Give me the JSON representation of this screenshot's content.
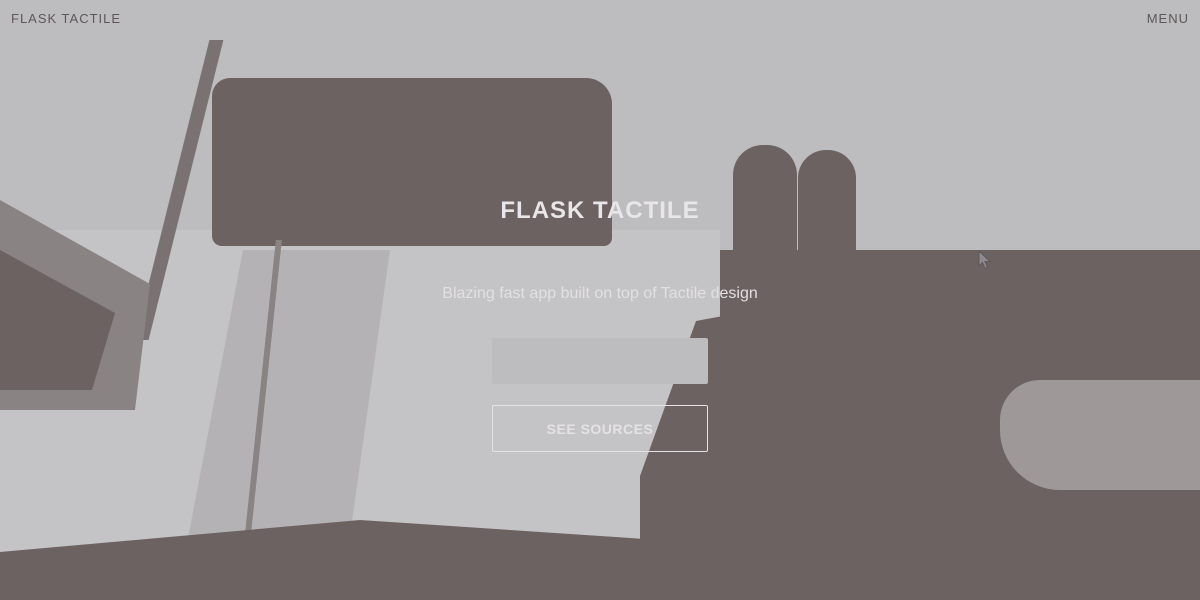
{
  "navbar": {
    "brand": "FLASK TACTILE",
    "menu_hint": "",
    "menu_label": "MENU"
  },
  "hero": {
    "title": "FLASK TACTILE",
    "subtitle": "Blazing fast app built on top of Tactile design",
    "input_value": "",
    "button_label": "SEE SOURCES"
  },
  "icons": {
    "cursor": "mouse-pointer-icon"
  },
  "colors": {
    "navbar_bg": "#bdbcbe",
    "dark_overlay": "#6c6262",
    "text_light": "#e8e6e8"
  }
}
